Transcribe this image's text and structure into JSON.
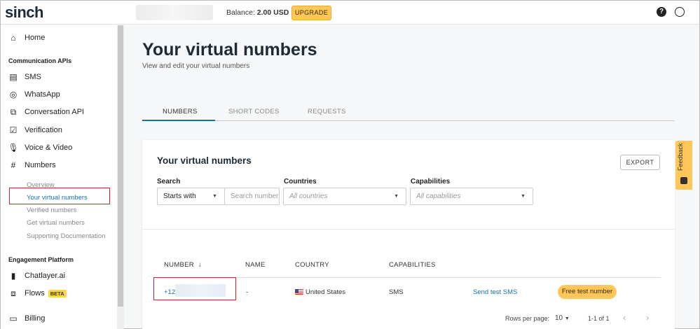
{
  "header": {
    "logo": "sinch",
    "balance_label": "Balance:",
    "balance_value": "2.00 USD",
    "upgrade_label": "UPGRADE"
  },
  "sidebar": {
    "home": "Home",
    "section_comm": "Communication APIs",
    "items": [
      "SMS",
      "WhatsApp",
      "Conversation API",
      "Verification",
      "Voice & Video",
      "Numbers"
    ],
    "numbers_sub": [
      "Overview",
      "Your virtual numbers",
      "Verified numbers",
      "Get virtual numbers",
      "Supporting Documentation"
    ],
    "section_engage": "Engagement Platform",
    "chatlayer": "Chatlayer.ai",
    "flows": "Flows",
    "flows_badge": "BETA",
    "billing": "Billing"
  },
  "page": {
    "title": "Your virtual numbers",
    "subtitle": "View and edit your virtual numbers",
    "tabs": [
      "NUMBERS",
      "SHORT CODES",
      "REQUESTS"
    ]
  },
  "card": {
    "title": "Your virtual numbers",
    "export_label": "EXPORT",
    "filters": {
      "search_label": "Search",
      "search_mode": "Starts with",
      "search_placeholder": "Search numbers",
      "countries_label": "Countries",
      "countries_value": "All countries",
      "capabilities_label": "Capabilities",
      "capabilities_value": "All capabilities"
    },
    "columns": [
      "NUMBER",
      "NAME",
      "COUNTRY",
      "CAPABILITIES"
    ],
    "sort_icon": "arrow-down",
    "rows": [
      {
        "number": "+12",
        "name": "-",
        "country": "United States",
        "capabilities": "SMS",
        "action_link": "Send test SMS",
        "action_button": "Free test number"
      }
    ],
    "pagination": {
      "rows_label": "Rows per page:",
      "rows_value": "10",
      "range": "1-1 of 1"
    }
  },
  "feedback_label": "Feedback"
}
